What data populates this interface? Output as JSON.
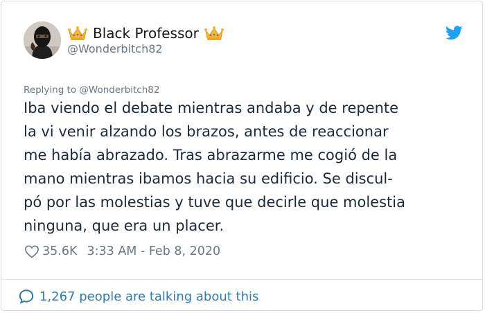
{
  "user": {
    "name": "Black Professor",
    "handle": "@Wonderbitch82"
  },
  "icons": {
    "verified_badge_left": "crown-icon",
    "verified_badge_right": "crown-icon",
    "brand": "twitter-bird-icon",
    "like": "heart-icon",
    "conversation": "speech-bubble-icon"
  },
  "colors": {
    "link": "#2b7bb9",
    "muted": "#697882",
    "twitter_blue": "#1da1f2",
    "text": "#1c2938"
  },
  "tweet": {
    "replying_to": "Replying to @Wonderbitch82",
    "lines": [
      "Iba viendo el debate mientras andaba y de repente",
      "la vi venir alzando los brazos, antes de reaccionar",
      "me había abrazado. Tras abrazarme me cogió de la",
      "mano mientras ibamos hacia su edificio. Se discul-",
      "pó por las molestias y tuve que decirle que molestia",
      "ninguna, que era un placer."
    ],
    "likes": "35.6K",
    "timestamp": "3:33 AM - Feb 8, 2020"
  },
  "footer": {
    "talking": "1,267 people are talking about this"
  }
}
